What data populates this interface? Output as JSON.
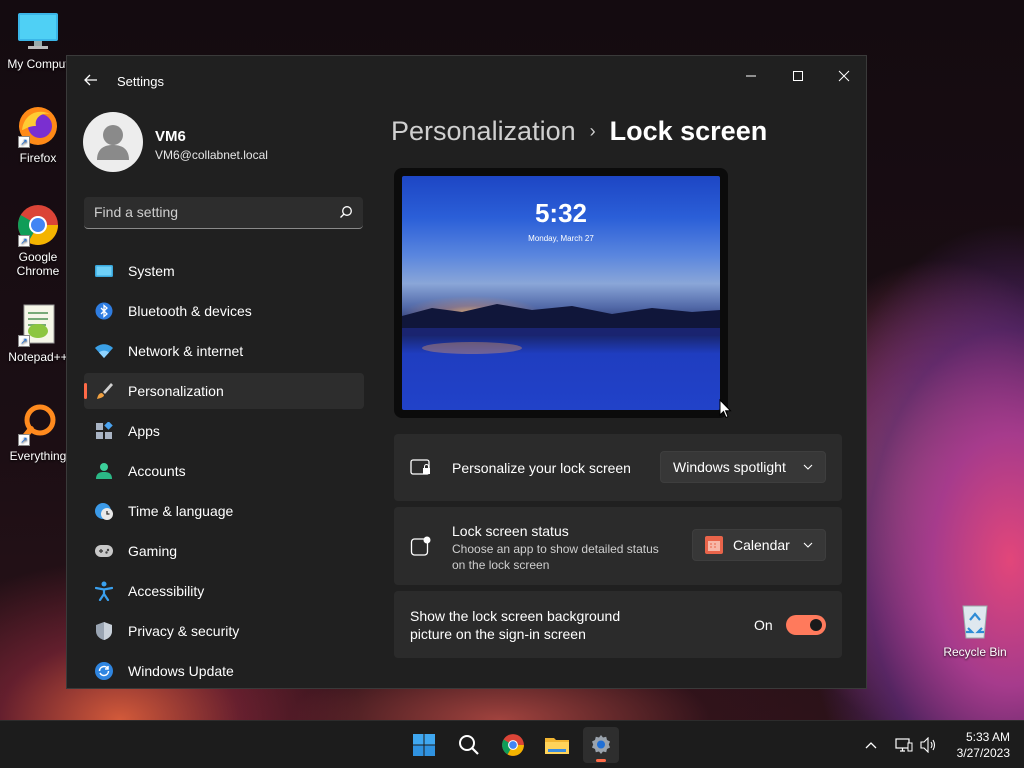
{
  "desktop": {
    "icons": [
      {
        "label": "My Comput",
        "icon": "monitor-icon"
      },
      {
        "label": "Firefox",
        "icon": "firefox-icon"
      },
      {
        "label": "Google Chrome",
        "icon": "chrome-icon"
      },
      {
        "label": "Notepad++",
        "icon": "notepadpp-icon"
      },
      {
        "label": "Everything",
        "icon": "everything-icon"
      },
      {
        "label": "Recycle Bin",
        "icon": "recycle-bin-icon"
      }
    ]
  },
  "window": {
    "title": "Settings",
    "accent": "#ff6a47"
  },
  "profile": {
    "name": "VM6",
    "email": "VM6@collabnet.local"
  },
  "search": {
    "placeholder": "Find a setting"
  },
  "sidebar": {
    "items": [
      {
        "label": "System",
        "icon": "system-icon",
        "selected": false
      },
      {
        "label": "Bluetooth & devices",
        "icon": "bluetooth-icon",
        "selected": false
      },
      {
        "label": "Network & internet",
        "icon": "wifi-icon",
        "selected": false
      },
      {
        "label": "Personalization",
        "icon": "paintbrush-icon",
        "selected": true
      },
      {
        "label": "Apps",
        "icon": "apps-icon",
        "selected": false
      },
      {
        "label": "Accounts",
        "icon": "person-icon",
        "selected": false
      },
      {
        "label": "Time & language",
        "icon": "clock-globe-icon",
        "selected": false
      },
      {
        "label": "Gaming",
        "icon": "gamepad-icon",
        "selected": false
      },
      {
        "label": "Accessibility",
        "icon": "accessibility-icon",
        "selected": false
      },
      {
        "label": "Privacy & security",
        "icon": "shield-icon",
        "selected": false
      },
      {
        "label": "Windows Update",
        "icon": "update-icon",
        "selected": false
      }
    ]
  },
  "breadcrumb": {
    "parent": "Personalization",
    "separator": "›",
    "current": "Lock screen"
  },
  "preview": {
    "time": "5:32",
    "date": "Monday, March 27"
  },
  "settings": {
    "personalize": {
      "label": "Personalize your lock screen",
      "value": "Windows spotlight"
    },
    "status": {
      "label": "Lock screen status",
      "description": "Choose an app to show detailed status on the lock screen",
      "value": "Calendar"
    },
    "signin_background": {
      "label": "Show the lock screen background picture on the sign-in screen",
      "state": "On",
      "enabled": true
    }
  },
  "taskbar": {
    "apps": [
      "start-icon",
      "search-icon",
      "chrome-icon",
      "file-explorer-icon",
      "settings-icon"
    ],
    "active": "settings-icon",
    "time": "5:33 AM",
    "date": "3/27/2023"
  }
}
